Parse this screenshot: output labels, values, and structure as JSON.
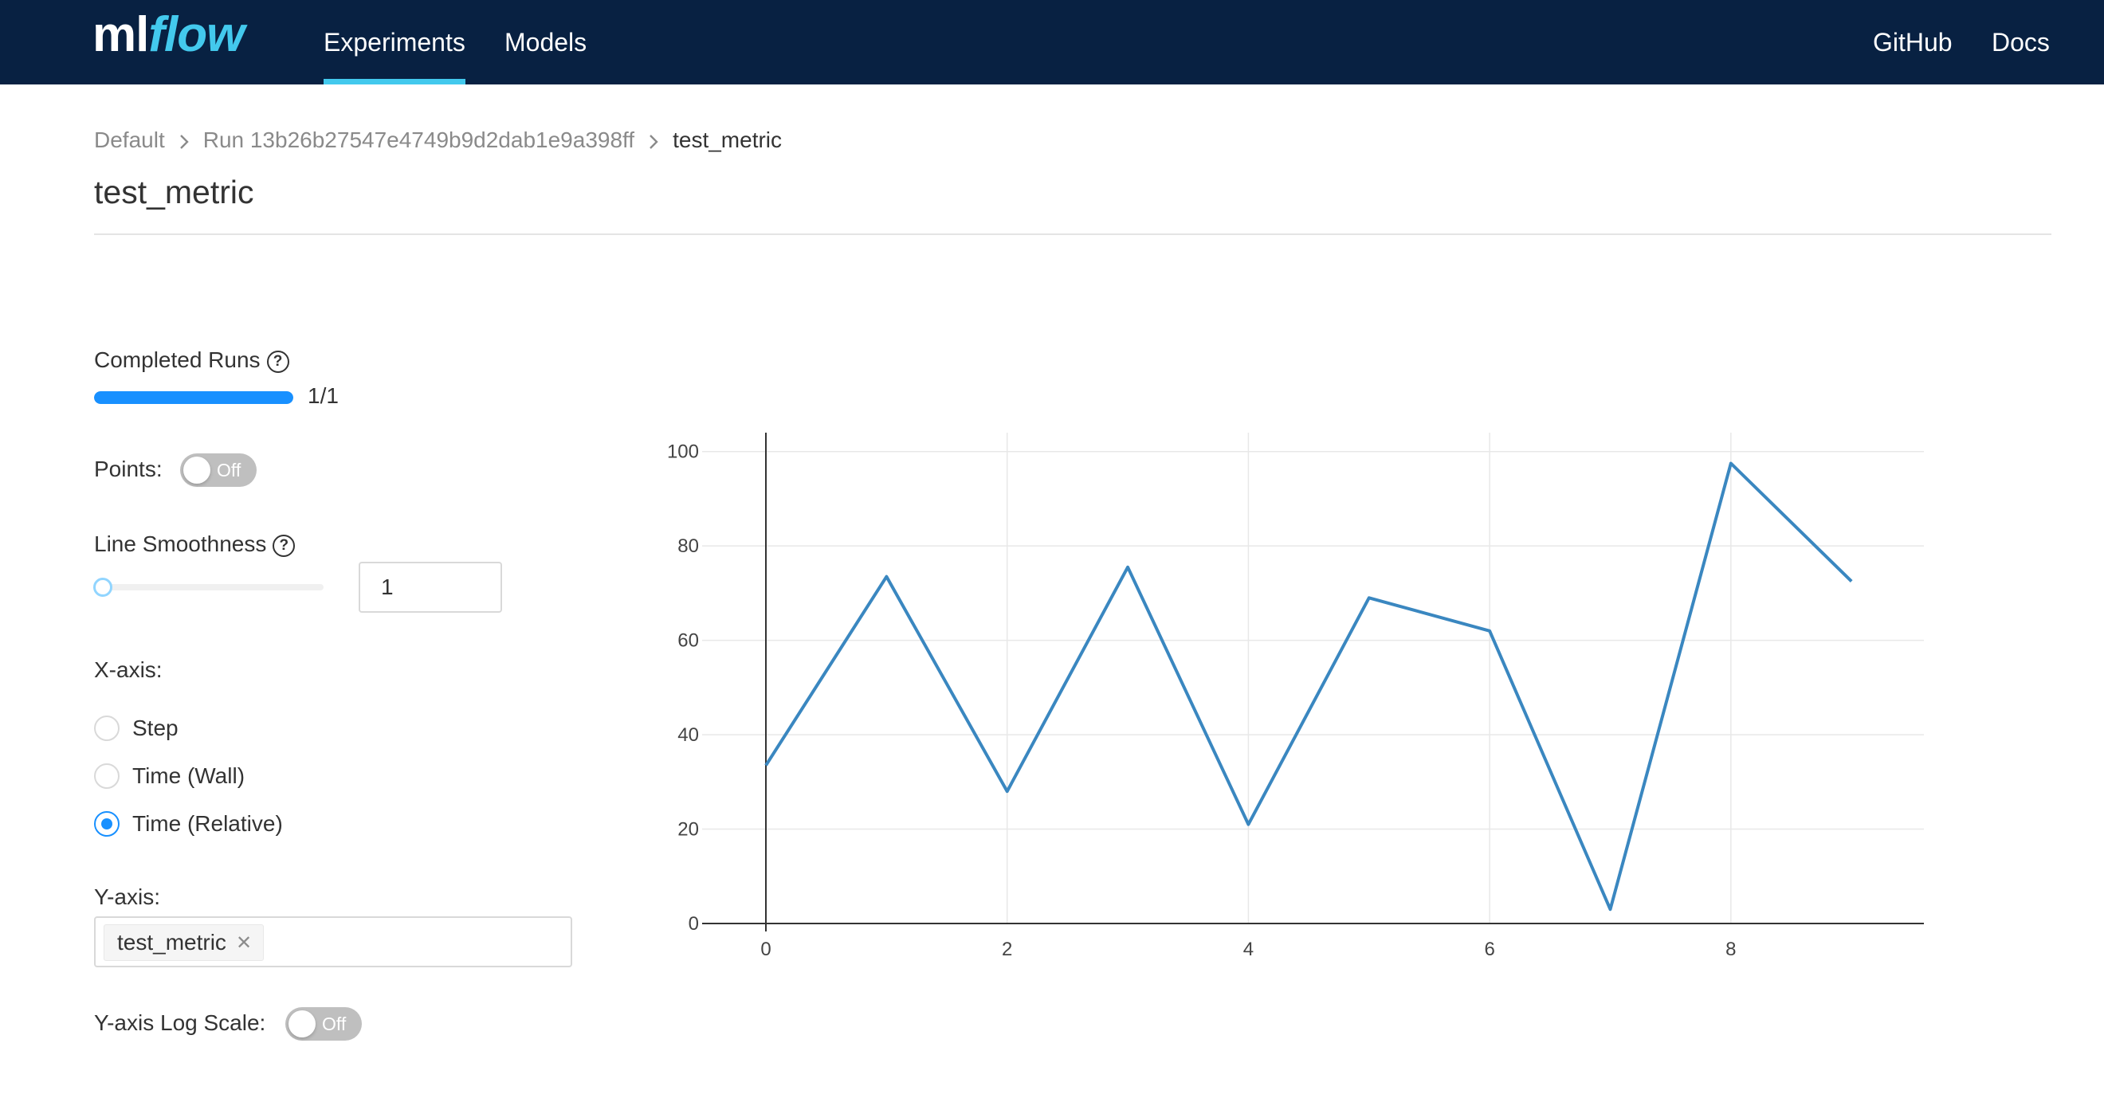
{
  "header": {
    "logo_ml": "ml",
    "logo_flow": "flow",
    "nav_left": [
      "Experiments",
      "Models"
    ],
    "nav_right": [
      "GitHub",
      "Docs"
    ],
    "active_nav": "Experiments",
    "colors": {
      "background": "#082142",
      "accent": "#43c9ed"
    }
  },
  "breadcrumb": {
    "items": [
      "Default",
      "Run 13b26b27547e4749b9d2dab1e9a398ff",
      "test_metric"
    ],
    "separator_icon": "chevron-right-icon"
  },
  "page_title": "test_metric",
  "controls": {
    "completed_runs": {
      "label": "Completed Runs",
      "text": "1/1",
      "progress": 1.0,
      "help_icon": "question-circle-icon"
    },
    "points": {
      "label": "Points:",
      "state": "Off"
    },
    "line_smoothness": {
      "label": "Line Smoothness",
      "value": "1",
      "slider_fraction": 0.0,
      "help_icon": "question-circle-icon"
    },
    "x_axis": {
      "label": "X-axis:",
      "options": [
        "Step",
        "Time (Wall)",
        "Time (Relative)"
      ],
      "selected": "Time (Relative)"
    },
    "y_axis": {
      "label": "Y-axis:",
      "tags": [
        "test_metric"
      ],
      "tag_remove_icon": "close-icon"
    },
    "y_log_scale": {
      "label": "Y-axis Log Scale:",
      "state": "Off"
    },
    "colors": {
      "primary": "#1890ff",
      "toggle_off": "#bfbfbf"
    }
  },
  "chart_data": {
    "type": "line",
    "x": [
      0,
      1,
      2,
      3,
      4,
      5,
      6,
      7,
      8,
      9
    ],
    "series": [
      {
        "values": [
          33.5,
          73.5,
          28,
          75.5,
          21,
          69,
          62,
          3,
          97.5,
          72.5
        ],
        "color": "#3a87c0"
      }
    ],
    "xticks": [
      "0",
      "2",
      "4",
      "6",
      "8"
    ],
    "yticks": [
      "0",
      "20",
      "40",
      "60",
      "80",
      "100"
    ],
    "xlim": [
      0,
      9.6
    ],
    "ylim": [
      0,
      104
    ],
    "grid": true,
    "legend": "none"
  }
}
